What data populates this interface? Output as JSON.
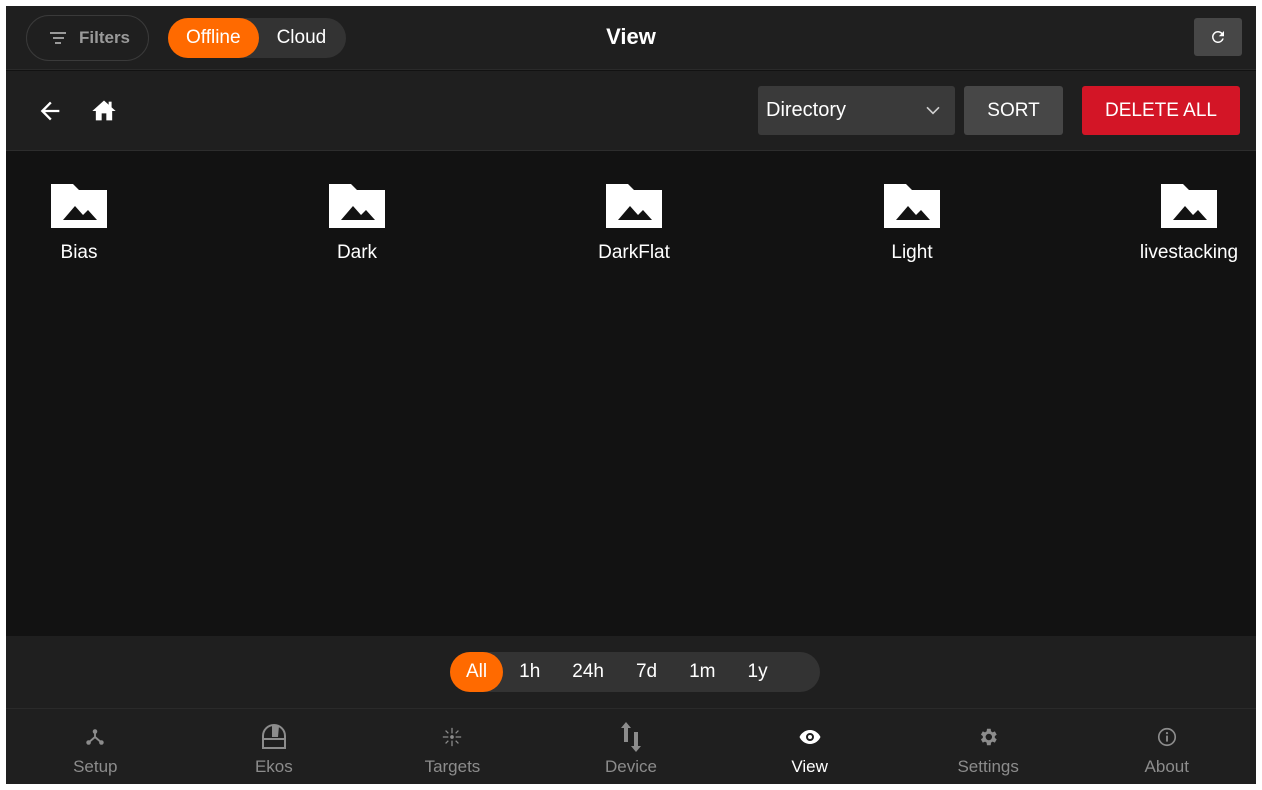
{
  "header": {
    "filters_label": "Filters",
    "source_options": [
      {
        "label": "Offline",
        "active": true
      },
      {
        "label": "Cloud",
        "active": false
      }
    ],
    "title": "View",
    "refresh_icon": "refresh-icon"
  },
  "toolbar": {
    "back_icon": "arrow-left-icon",
    "home_icon": "home-icon",
    "select_value": "Directory",
    "sort_label": "SORT",
    "delete_label": "DELETE ALL"
  },
  "folders": [
    {
      "name": "Bias"
    },
    {
      "name": "Dark"
    },
    {
      "name": "DarkFlat"
    },
    {
      "name": "Light"
    },
    {
      "name": "livestacking"
    }
  ],
  "time_filter": {
    "options": [
      "All",
      "1h",
      "24h",
      "7d",
      "1m",
      "1y"
    ],
    "selected": "All"
  },
  "nav": {
    "items": [
      {
        "label": "Setup",
        "icon": "setup-icon"
      },
      {
        "label": "Ekos",
        "icon": "ekos-icon"
      },
      {
        "label": "Targets",
        "icon": "targets-icon"
      },
      {
        "label": "Device",
        "icon": "device-icon"
      },
      {
        "label": "View",
        "icon": "eye-icon",
        "active": true
      },
      {
        "label": "Settings",
        "icon": "gear-icon"
      },
      {
        "label": "About",
        "icon": "info-icon"
      }
    ]
  },
  "colors": {
    "accent": "#ff6a00",
    "danger": "#d31526",
    "background": "#121212",
    "surface": "#1f1f1f"
  }
}
